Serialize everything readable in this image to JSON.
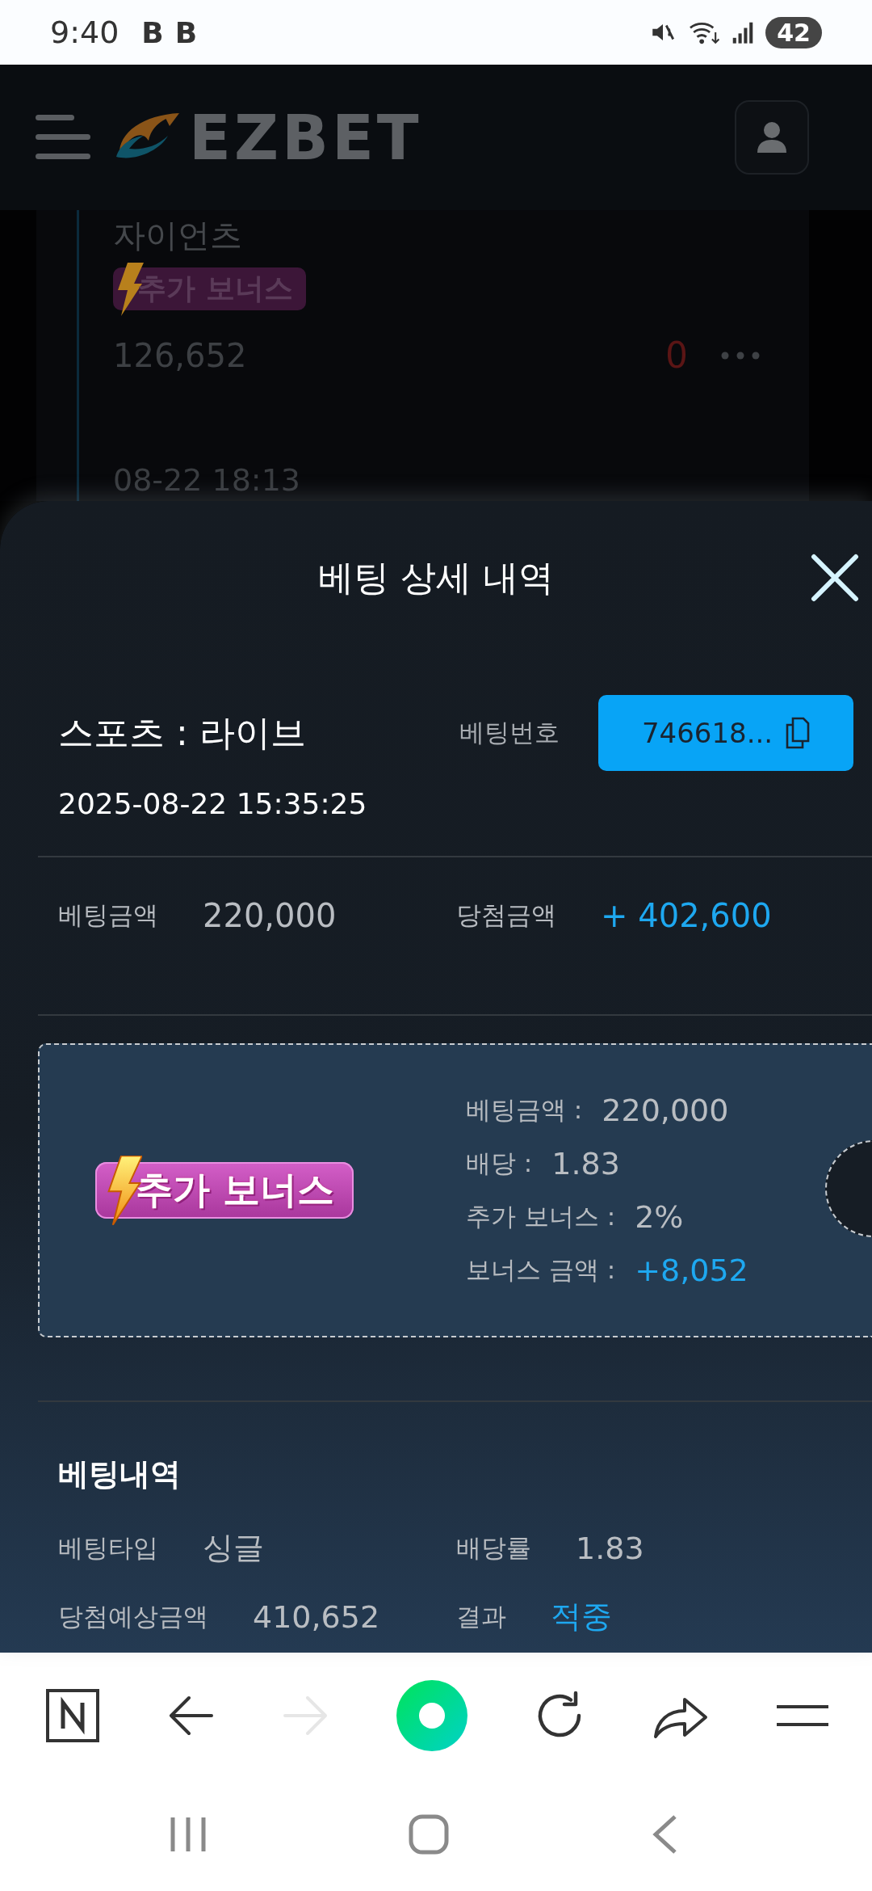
{
  "status_bar": {
    "time": "9:40",
    "notifications": [
      "B",
      "B"
    ],
    "battery": "42"
  },
  "header": {
    "logo": "EZBET"
  },
  "background_card": {
    "team": "자이언츠",
    "badge": "추가 보너스",
    "amount": "126,652",
    "result": "0",
    "date": "08-22 18:13"
  },
  "sheet": {
    "title": "베팅 상세 내역",
    "category": "스포츠 : 라이브",
    "bet_number_label": "베팅번호",
    "bet_number": "746618...",
    "datetime": "2025-08-22 15:35:25",
    "summary": [
      {
        "label": "베팅금액",
        "value": "220,000",
        "highlight": false
      },
      {
        "label": "당첨금액",
        "value": "+ 402,600",
        "highlight": true
      }
    ],
    "bonus": {
      "badge": "추가 보너스",
      "lines": [
        {
          "label": "베팅금액 :",
          "value": "220,000",
          "highlight": false
        },
        {
          "label": "배당 :",
          "value": "1.83",
          "highlight": false
        },
        {
          "label": "추가 보너스 :",
          "value": "2%",
          "highlight": false
        },
        {
          "label": "보너스 금액 :",
          "value": "+8,052",
          "highlight": true
        }
      ]
    },
    "history": {
      "title": "베팅내역",
      "fields": [
        {
          "label": "베팅타입",
          "value": "싱글",
          "highlight": false
        },
        {
          "label": "배당률",
          "value": "1.83",
          "highlight": false
        },
        {
          "label": "당첨예상금액",
          "value": "410,652",
          "highlight": false
        },
        {
          "label": "결과",
          "value": "적중",
          "highlight": true
        }
      ]
    }
  },
  "browser_toolbar": {
    "buttons": [
      {
        "kind": "home",
        "disabled": false
      },
      {
        "kind": "back",
        "disabled": false
      },
      {
        "kind": "forward",
        "disabled": true
      },
      {
        "kind": "assistant",
        "disabled": false
      },
      {
        "kind": "reload",
        "disabled": false
      },
      {
        "kind": "share",
        "disabled": false
      },
      {
        "kind": "menu",
        "disabled": false
      }
    ]
  }
}
